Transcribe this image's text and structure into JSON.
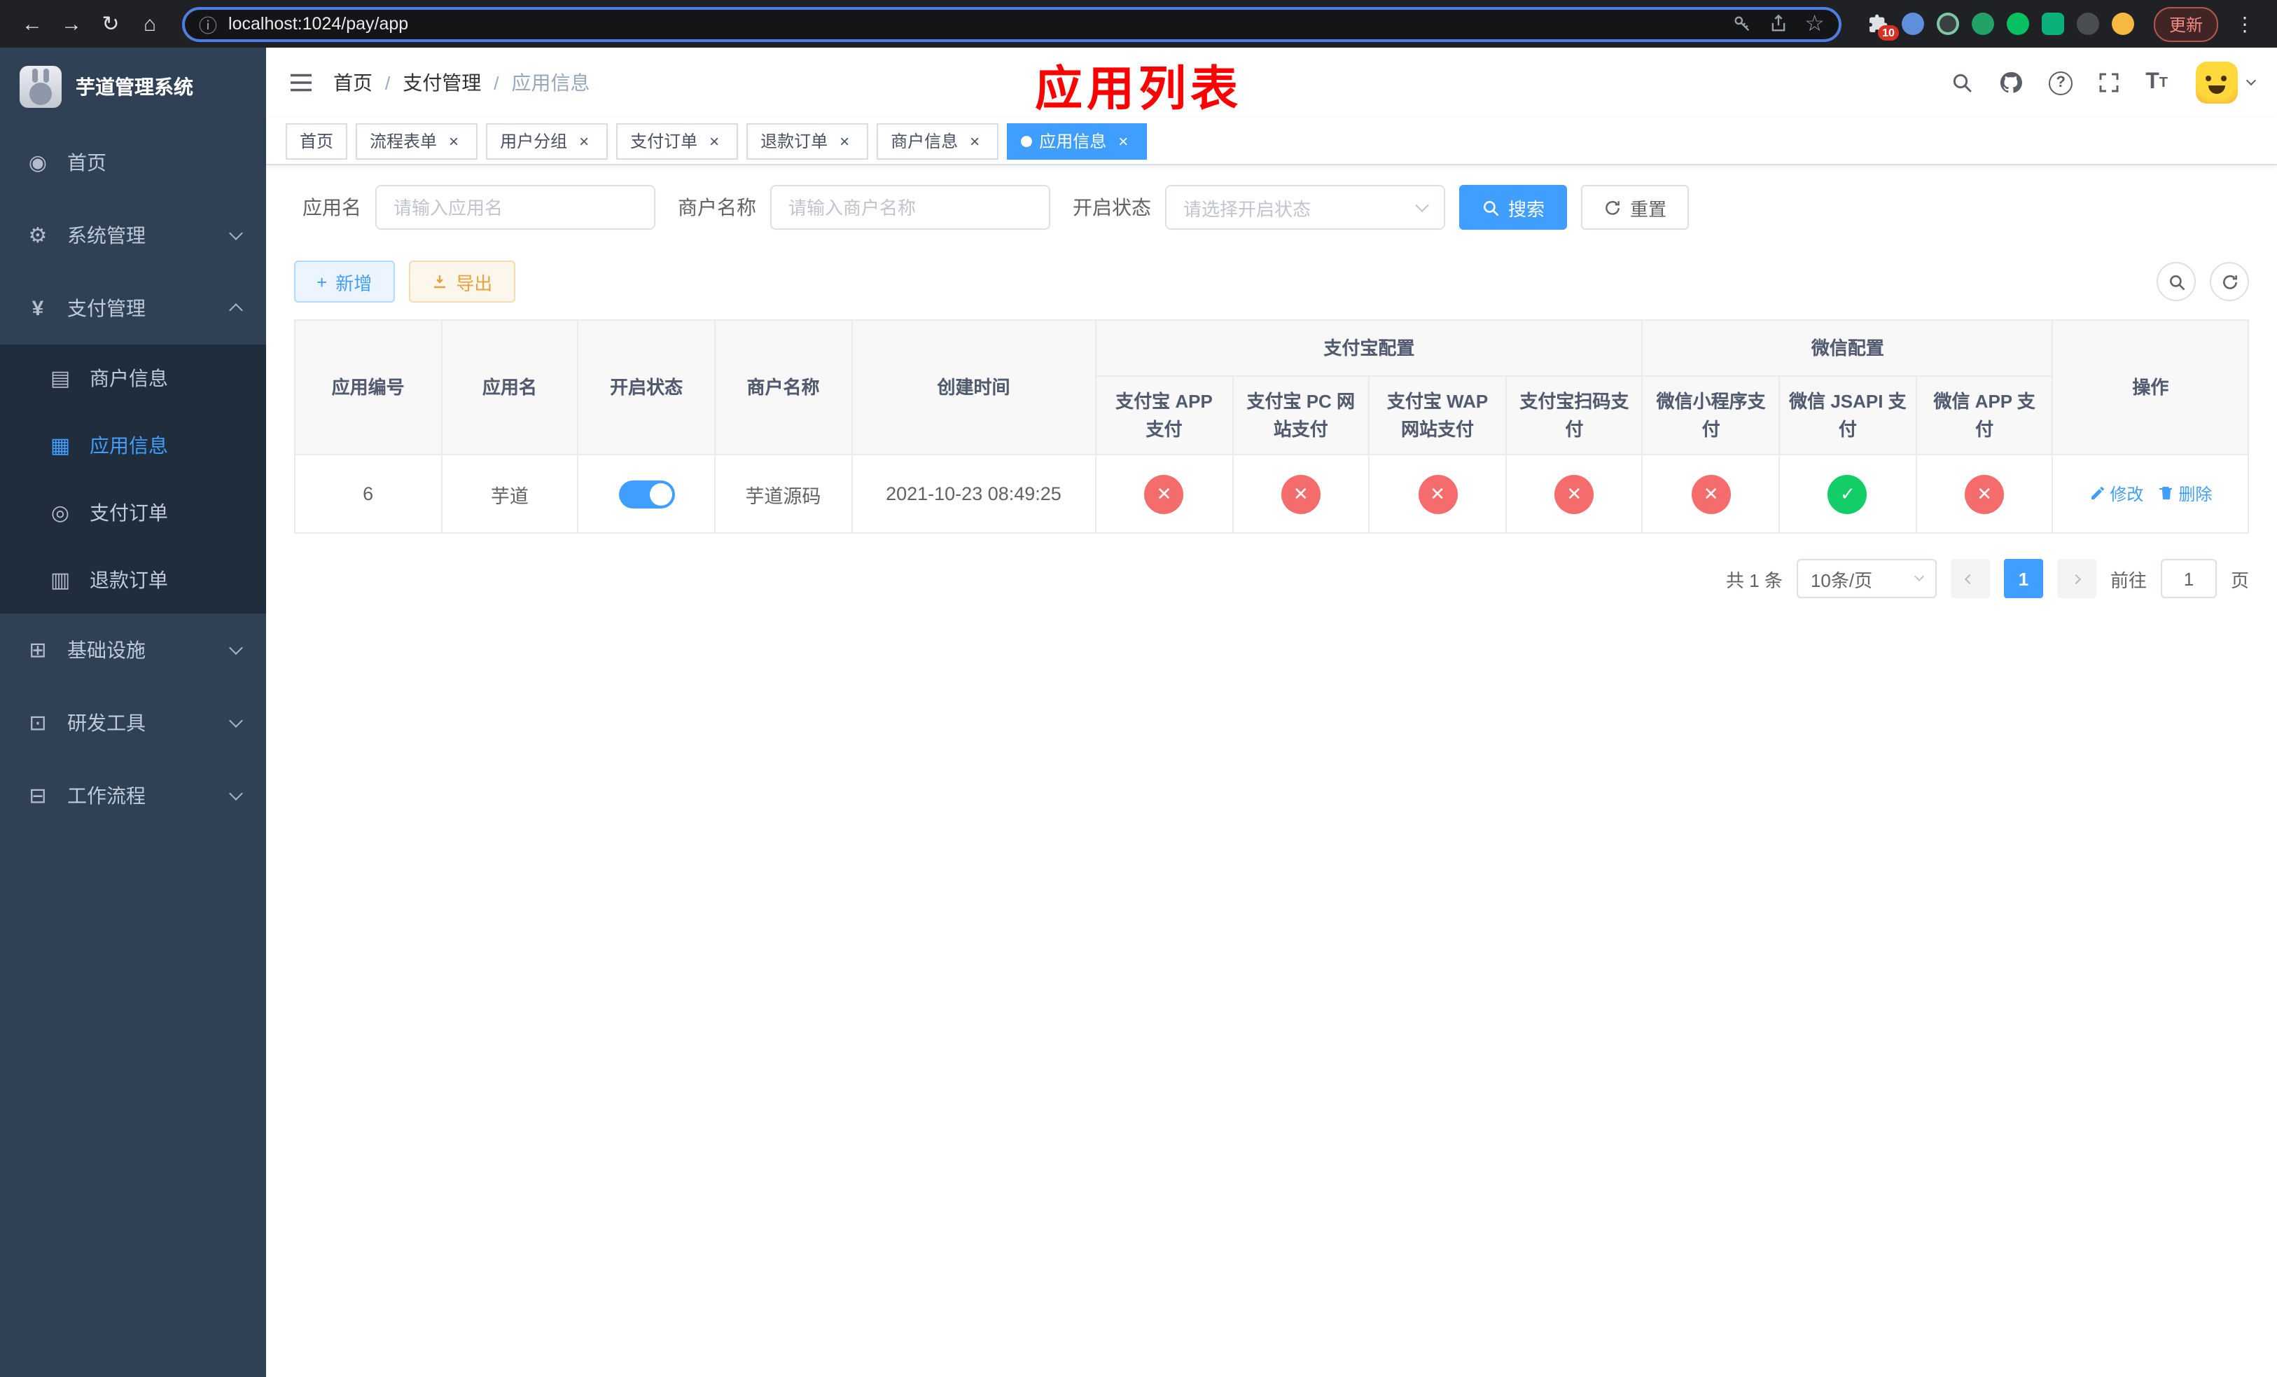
{
  "browser": {
    "url": "localhost:1024/pay/app",
    "extensions_badge": "10",
    "update_button": "更新"
  },
  "icons": {
    "check": "✓",
    "cross": "✕"
  },
  "colors": {
    "primary": "#409eff",
    "success": "#13ce66",
    "danger": "#f56c6c",
    "warning": "#e6a23c",
    "annotation_red": "#ff0000",
    "sidebar_bg": "#304156",
    "submenu_bg": "#1f2d3d"
  },
  "sidebar": {
    "title": "芋道管理系统",
    "home": "首页",
    "system": "系统管理",
    "payment": "支付管理",
    "payment_children": [
      "商户信息",
      "应用信息",
      "支付订单",
      "退款订单"
    ],
    "infra": "基础设施",
    "devtools": "研发工具",
    "workflow": "工作流程"
  },
  "header": {
    "breadcrumb": [
      "首页",
      "支付管理",
      "应用信息"
    ],
    "annotation": "应用列表"
  },
  "tabs": [
    "首页",
    "流程表单",
    "用户分组",
    "支付订单",
    "退款订单",
    "商户信息",
    "应用信息"
  ],
  "filters": {
    "app_name_label": "应用名",
    "app_name_placeholder": "请输入应用名",
    "merchant_label": "商户名称",
    "merchant_placeholder": "请输入商户名称",
    "status_label": "开启状态",
    "status_placeholder": "请选择开启状态",
    "search": "搜索",
    "reset": "重置"
  },
  "toolbar": {
    "add": "新增",
    "export": "导出"
  },
  "table": {
    "col_app_id": "应用编号",
    "col_app_name": "应用名",
    "col_status": "开启状态",
    "col_merchant": "商户名称",
    "col_created": "创建时间",
    "group_alipay": "支付宝配置",
    "group_wechat": "微信配置",
    "col_alipay_app": "支付宝 APP 支付",
    "col_alipay_pc": "支付宝 PC 网站支付",
    "col_alipay_wap": "支付宝 WAP 网站支付",
    "col_alipay_qr": "支付宝扫码支付",
    "col_wx_mini": "微信小程序支付",
    "col_wx_jsapi": "微信 JSAPI 支付",
    "col_wx_app": "微信 APP 支付",
    "col_actions": "操作",
    "row": {
      "id": "6",
      "name": "芋道",
      "enabled": true,
      "merchant": "芋道源码",
      "created": "2021-10-23 08:49:25",
      "alipay_app": false,
      "alipay_pc": false,
      "alipay_wap": false,
      "alipay_qr": false,
      "wx_mini": false,
      "wx_jsapi": true,
      "wx_app": false,
      "edit": "修改",
      "delete": "删除"
    }
  },
  "pagination": {
    "total": "共 1 条",
    "page_size": "10条/页",
    "page": "1",
    "goto": "前往",
    "goto_value": "1",
    "unit": "页"
  }
}
